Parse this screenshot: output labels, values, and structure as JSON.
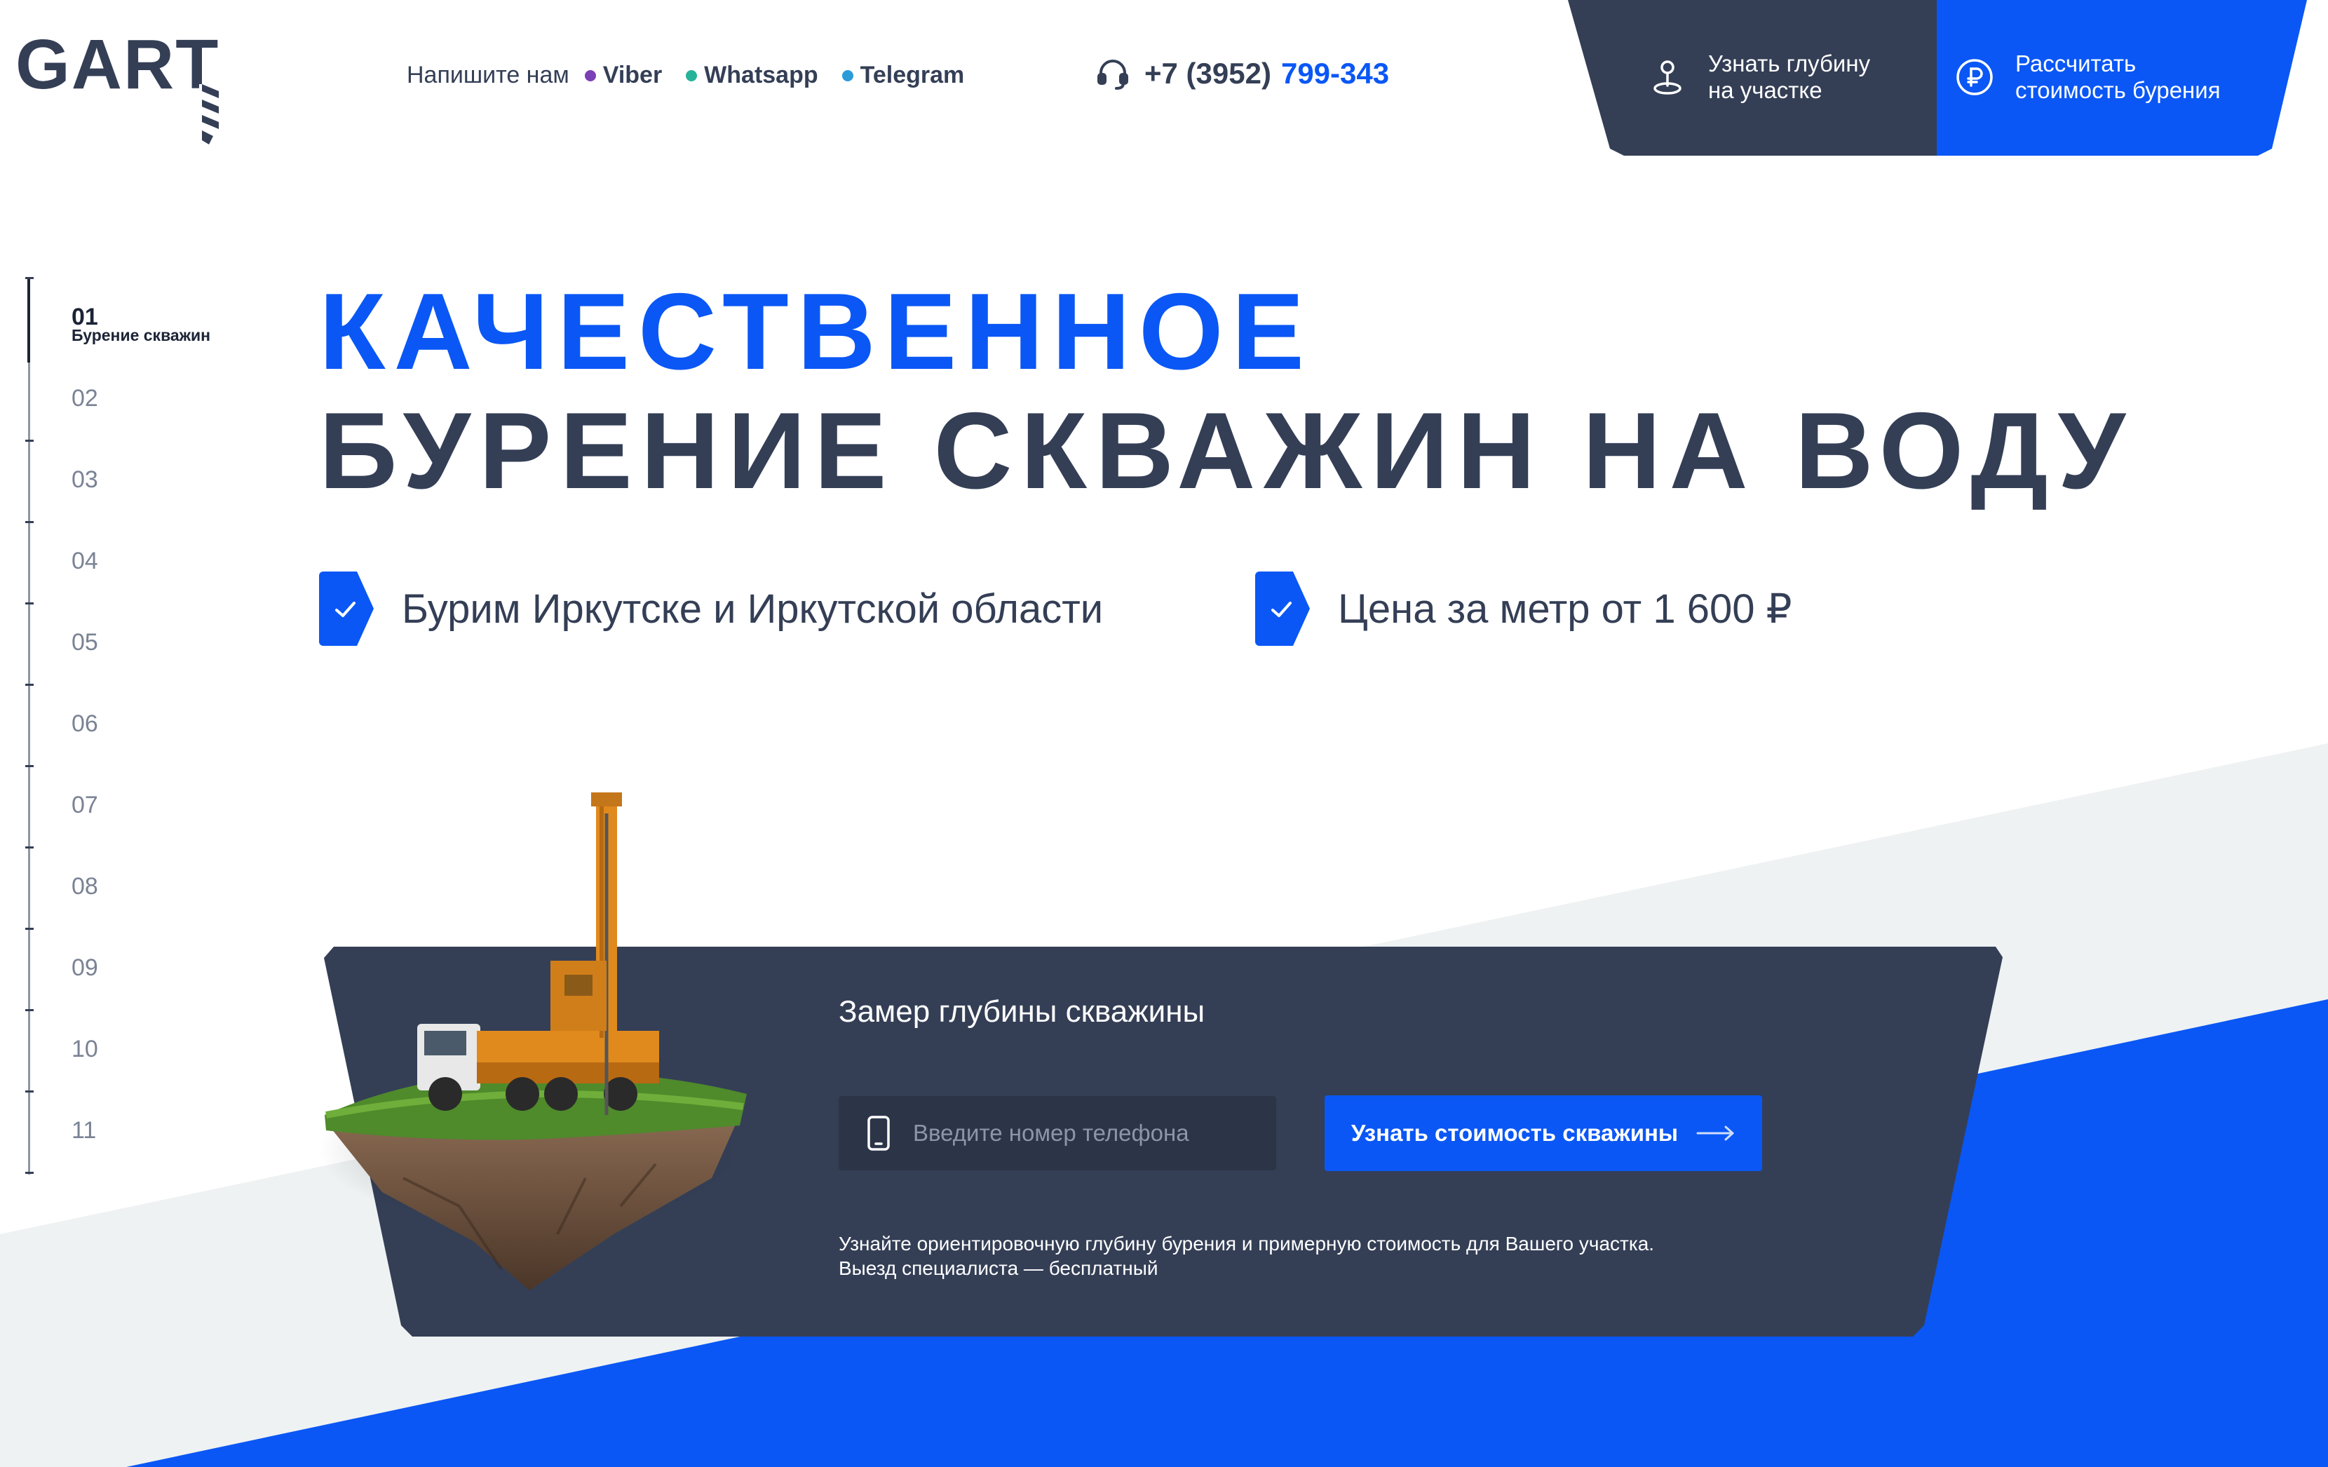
{
  "header": {
    "logo_text": "GART",
    "write_label": "Напишите нам",
    "messengers": [
      {
        "label": "Viber",
        "color": "#7b3fb6"
      },
      {
        "label": "Whatsapp",
        "color": "#26b39a"
      },
      {
        "label": "Telegram",
        "color": "#2b9bd9"
      }
    ],
    "phone_code": "+7 (3952)",
    "phone_number": "799-343",
    "btn_depth_line1": "Узнать глубину",
    "btn_depth_line2": "на участке",
    "btn_calc_line1": "Рассчитать",
    "btn_calc_line2": "стоимость бурения"
  },
  "sidenav": {
    "items": [
      "01",
      "02",
      "03",
      "04",
      "05",
      "06",
      "07",
      "08",
      "09",
      "10",
      "11"
    ],
    "active_sub": "Бурение скважин"
  },
  "hero": {
    "title_line1": "КАЧЕСТВЕННОЕ",
    "title_line2": "БУРЕНИЕ СКВАЖИН НА ВОДУ",
    "feature1": "Бурим Иркутске и Иркутской области",
    "feature2": "Цена за метр от 1 600 ₽"
  },
  "form": {
    "title": "Замер глубины скважины",
    "phone_placeholder": "Введите номер телефона",
    "cta_label": "Узнать стоимость скважины",
    "note_line1": "Узнайте ориентировочную глубину бурения и примерную стоимость для Вашего участка.",
    "note_line2": "Выезд специалиста — бесплатный"
  },
  "colors": {
    "accent": "#0a57f5",
    "dark": "#343f56",
    "light_bg": "#eef2f3"
  },
  "icons": [
    "location-pin-icon",
    "ruble-icon",
    "headset-icon",
    "check-icon",
    "mobile-phone-icon",
    "arrow-right-icon",
    "drill-rig-illustration"
  ]
}
